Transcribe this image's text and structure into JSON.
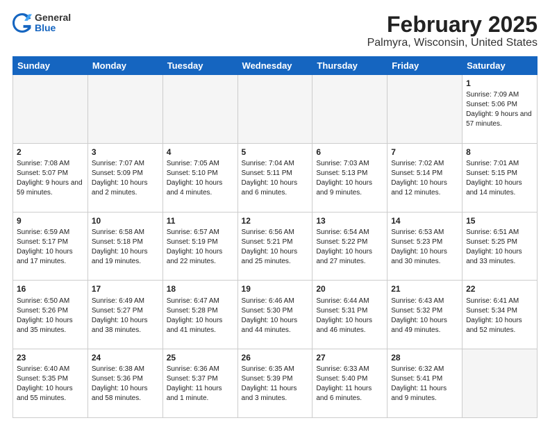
{
  "header": {
    "logo_general": "General",
    "logo_blue": "Blue",
    "month_title": "February 2025",
    "location": "Palmyra, Wisconsin, United States"
  },
  "weekdays": [
    "Sunday",
    "Monday",
    "Tuesday",
    "Wednesday",
    "Thursday",
    "Friday",
    "Saturday"
  ],
  "weeks": [
    [
      {
        "day": "",
        "info": ""
      },
      {
        "day": "",
        "info": ""
      },
      {
        "day": "",
        "info": ""
      },
      {
        "day": "",
        "info": ""
      },
      {
        "day": "",
        "info": ""
      },
      {
        "day": "",
        "info": ""
      },
      {
        "day": "1",
        "info": "Sunrise: 7:09 AM\nSunset: 5:06 PM\nDaylight: 9 hours and 57 minutes."
      }
    ],
    [
      {
        "day": "2",
        "info": "Sunrise: 7:08 AM\nSunset: 5:07 PM\nDaylight: 9 hours and 59 minutes."
      },
      {
        "day": "3",
        "info": "Sunrise: 7:07 AM\nSunset: 5:09 PM\nDaylight: 10 hours and 2 minutes."
      },
      {
        "day": "4",
        "info": "Sunrise: 7:05 AM\nSunset: 5:10 PM\nDaylight: 10 hours and 4 minutes."
      },
      {
        "day": "5",
        "info": "Sunrise: 7:04 AM\nSunset: 5:11 PM\nDaylight: 10 hours and 6 minutes."
      },
      {
        "day": "6",
        "info": "Sunrise: 7:03 AM\nSunset: 5:13 PM\nDaylight: 10 hours and 9 minutes."
      },
      {
        "day": "7",
        "info": "Sunrise: 7:02 AM\nSunset: 5:14 PM\nDaylight: 10 hours and 12 minutes."
      },
      {
        "day": "8",
        "info": "Sunrise: 7:01 AM\nSunset: 5:15 PM\nDaylight: 10 hours and 14 minutes."
      }
    ],
    [
      {
        "day": "9",
        "info": "Sunrise: 6:59 AM\nSunset: 5:17 PM\nDaylight: 10 hours and 17 minutes."
      },
      {
        "day": "10",
        "info": "Sunrise: 6:58 AM\nSunset: 5:18 PM\nDaylight: 10 hours and 19 minutes."
      },
      {
        "day": "11",
        "info": "Sunrise: 6:57 AM\nSunset: 5:19 PM\nDaylight: 10 hours and 22 minutes."
      },
      {
        "day": "12",
        "info": "Sunrise: 6:56 AM\nSunset: 5:21 PM\nDaylight: 10 hours and 25 minutes."
      },
      {
        "day": "13",
        "info": "Sunrise: 6:54 AM\nSunset: 5:22 PM\nDaylight: 10 hours and 27 minutes."
      },
      {
        "day": "14",
        "info": "Sunrise: 6:53 AM\nSunset: 5:23 PM\nDaylight: 10 hours and 30 minutes."
      },
      {
        "day": "15",
        "info": "Sunrise: 6:51 AM\nSunset: 5:25 PM\nDaylight: 10 hours and 33 minutes."
      }
    ],
    [
      {
        "day": "16",
        "info": "Sunrise: 6:50 AM\nSunset: 5:26 PM\nDaylight: 10 hours and 35 minutes."
      },
      {
        "day": "17",
        "info": "Sunrise: 6:49 AM\nSunset: 5:27 PM\nDaylight: 10 hours and 38 minutes."
      },
      {
        "day": "18",
        "info": "Sunrise: 6:47 AM\nSunset: 5:28 PM\nDaylight: 10 hours and 41 minutes."
      },
      {
        "day": "19",
        "info": "Sunrise: 6:46 AM\nSunset: 5:30 PM\nDaylight: 10 hours and 44 minutes."
      },
      {
        "day": "20",
        "info": "Sunrise: 6:44 AM\nSunset: 5:31 PM\nDaylight: 10 hours and 46 minutes."
      },
      {
        "day": "21",
        "info": "Sunrise: 6:43 AM\nSunset: 5:32 PM\nDaylight: 10 hours and 49 minutes."
      },
      {
        "day": "22",
        "info": "Sunrise: 6:41 AM\nSunset: 5:34 PM\nDaylight: 10 hours and 52 minutes."
      }
    ],
    [
      {
        "day": "23",
        "info": "Sunrise: 6:40 AM\nSunset: 5:35 PM\nDaylight: 10 hours and 55 minutes."
      },
      {
        "day": "24",
        "info": "Sunrise: 6:38 AM\nSunset: 5:36 PM\nDaylight: 10 hours and 58 minutes."
      },
      {
        "day": "25",
        "info": "Sunrise: 6:36 AM\nSunset: 5:37 PM\nDaylight: 11 hours and 1 minute."
      },
      {
        "day": "26",
        "info": "Sunrise: 6:35 AM\nSunset: 5:39 PM\nDaylight: 11 hours and 3 minutes."
      },
      {
        "day": "27",
        "info": "Sunrise: 6:33 AM\nSunset: 5:40 PM\nDaylight: 11 hours and 6 minutes."
      },
      {
        "day": "28",
        "info": "Sunrise: 6:32 AM\nSunset: 5:41 PM\nDaylight: 11 hours and 9 minutes."
      },
      {
        "day": "",
        "info": ""
      }
    ]
  ]
}
